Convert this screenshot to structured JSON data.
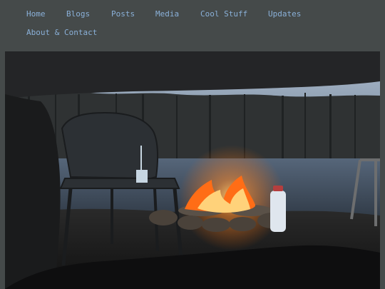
{
  "nav": {
    "items": [
      {
        "label": "Home"
      },
      {
        "label": "Blogs"
      },
      {
        "label": "Posts"
      },
      {
        "label": "Media"
      },
      {
        "label": "Cool Stuff"
      },
      {
        "label": "Updates"
      },
      {
        "label": "About & Contact"
      }
    ],
    "link_color": "#8ab0d8",
    "background_color": "#454a4a"
  },
  "hero": {
    "palette": {
      "sky": "#9fb3c7",
      "water": "#3e4c5e",
      "fire": "#ff7a1a",
      "shadow": "#151718"
    }
  }
}
